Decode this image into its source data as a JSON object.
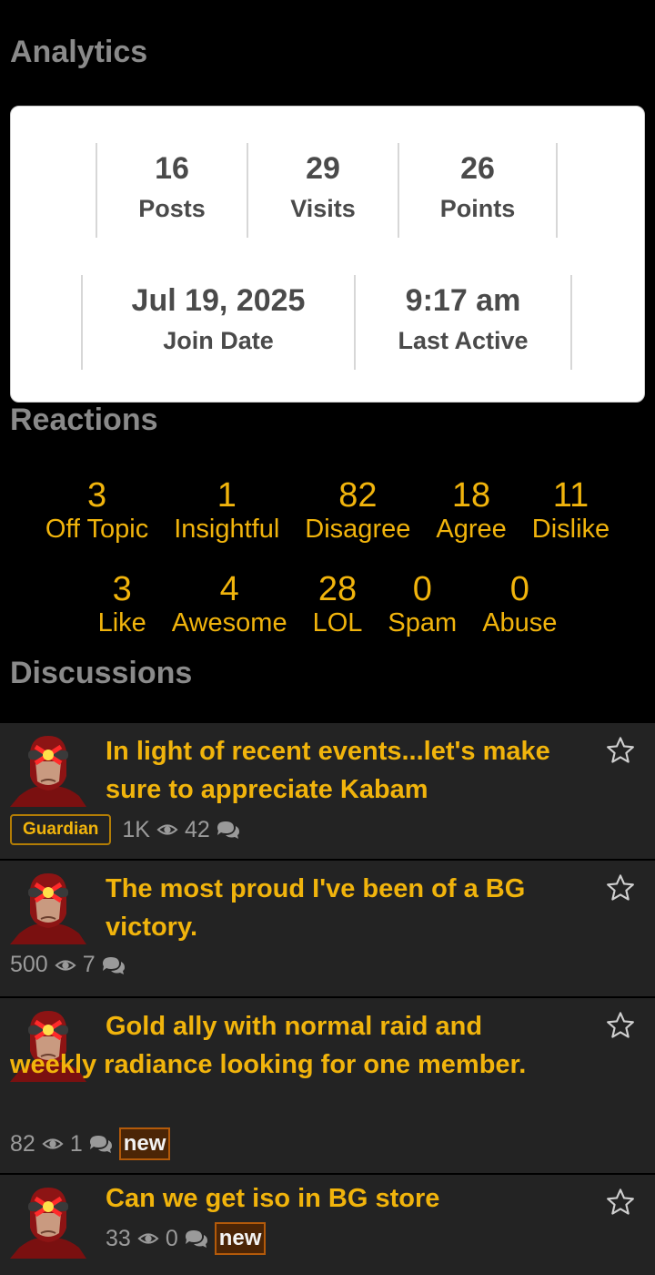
{
  "analytics": {
    "title": "Analytics",
    "stats_row1": [
      {
        "value": "16",
        "label": "Posts"
      },
      {
        "value": "29",
        "label": "Visits"
      },
      {
        "value": "26",
        "label": "Points"
      }
    ],
    "stats_row2": [
      {
        "value": "Jul 19, 2025",
        "label": "Join Date"
      },
      {
        "value": "9:17 am",
        "label": "Last Active"
      }
    ]
  },
  "reactions": {
    "title": "Reactions",
    "row1": [
      {
        "count": "3",
        "label": "Off Topic"
      },
      {
        "count": "1",
        "label": "Insightful"
      },
      {
        "count": "82",
        "label": "Disagree"
      },
      {
        "count": "18",
        "label": "Agree"
      },
      {
        "count": "11",
        "label": "Dislike"
      }
    ],
    "row2": [
      {
        "count": "3",
        "label": "Like"
      },
      {
        "count": "4",
        "label": "Awesome"
      },
      {
        "count": "28",
        "label": "LOL"
      },
      {
        "count": "0",
        "label": "Spam"
      },
      {
        "count": "0",
        "label": "Abuse"
      }
    ]
  },
  "discussions": {
    "title": "Discussions",
    "items": [
      {
        "title": "In light of recent events...let's make sure to appreciate Kabam",
        "badge": "Guardian",
        "views": "1K",
        "comments": "42",
        "new": ""
      },
      {
        "title": "The most proud I've been of a BG victory.",
        "badge": "",
        "views": "500",
        "comments": "7",
        "new": ""
      },
      {
        "title": "Gold ally with normal raid and weekly radiance looking for one member.",
        "badge": "",
        "views": "82",
        "comments": "1",
        "new": "new"
      },
      {
        "title": "Can we get iso in BG store",
        "badge": "",
        "views": "33",
        "comments": "0",
        "new": "new"
      }
    ]
  },
  "colors": {
    "accent": "#f1b40c",
    "card_bg": "#ffffff",
    "row_bg": "#232323"
  },
  "icons": [
    "eye-icon",
    "comments-icon",
    "star-icon",
    "avatar-cyclops"
  ]
}
